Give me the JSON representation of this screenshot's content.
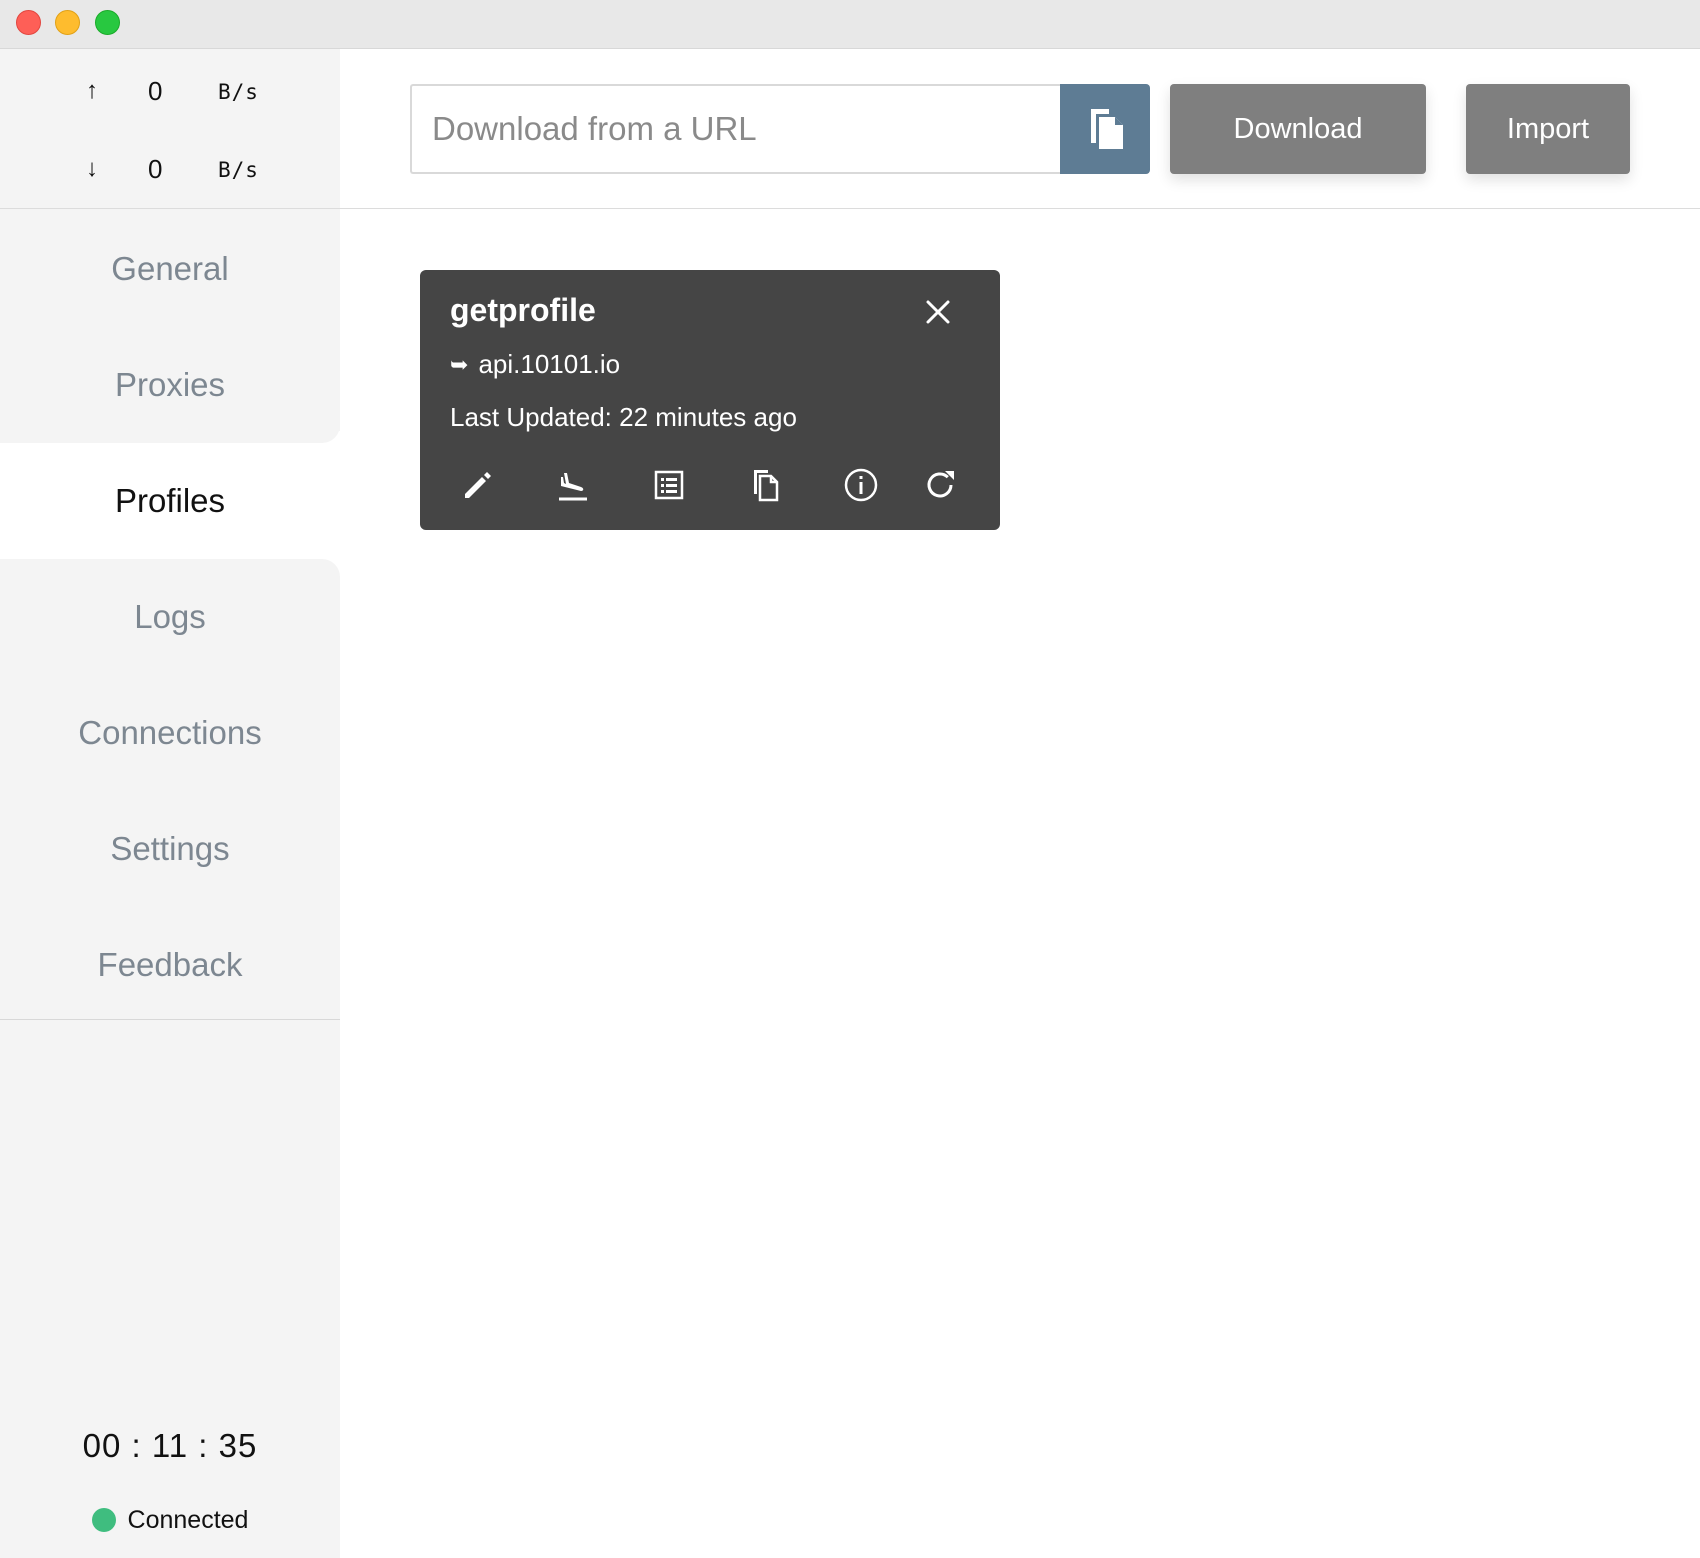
{
  "traffic": {
    "up": {
      "arrow": "↑",
      "value": "0",
      "unit": "B/s"
    },
    "down": {
      "arrow": "↓",
      "value": "0",
      "unit": "B/s"
    }
  },
  "nav": {
    "items": [
      {
        "label": "General"
      },
      {
        "label": "Proxies"
      },
      {
        "label": "Profiles"
      },
      {
        "label": "Logs"
      },
      {
        "label": "Connections"
      },
      {
        "label": "Settings"
      },
      {
        "label": "Feedback"
      }
    ],
    "active": "Profiles"
  },
  "footer": {
    "timer": "00 : 11 : 35",
    "status": "Connected",
    "status_color": "#3fbd7f"
  },
  "toolbar": {
    "url_placeholder": "Download from a URL",
    "paste_icon": "paste-icon",
    "download_label": "Download",
    "import_label": "Import"
  },
  "profile_card": {
    "name": "getprofile",
    "host_icon": "➥",
    "host": "api.10101.io",
    "updated": "Last Updated: 22 minutes ago",
    "actions": [
      "edit-icon",
      "flight-land-icon",
      "list-icon",
      "copy-icon",
      "info-icon",
      "refresh-icon"
    ]
  },
  "colors": {
    "accent": "#5e7c94",
    "button": "#7f7f7f",
    "card": "#454545",
    "sidebar": "#f4f4f4"
  }
}
